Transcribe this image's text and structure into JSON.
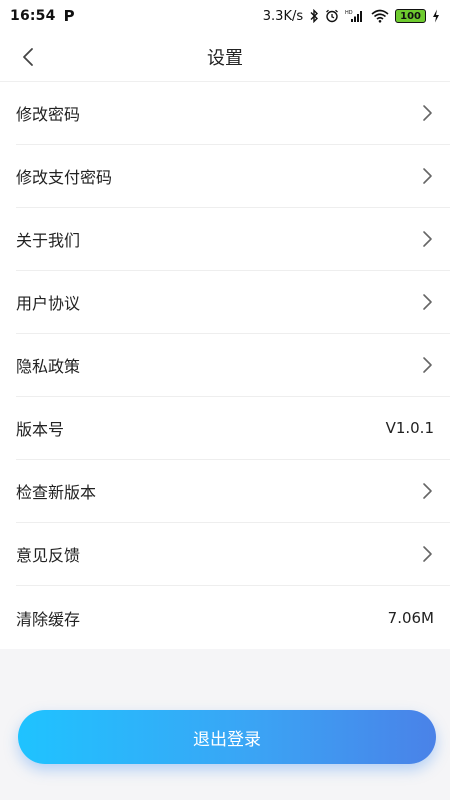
{
  "status_bar": {
    "time": "16:54",
    "app_badge": "P",
    "network_speed": "3.3K/s",
    "hd_label": "HD",
    "battery_level": "100"
  },
  "nav": {
    "title": "设置"
  },
  "settings": [
    {
      "label": "修改密码",
      "type": "link"
    },
    {
      "label": "修改支付密码",
      "type": "link"
    },
    {
      "label": "关于我们",
      "type": "link"
    },
    {
      "label": "用户协议",
      "type": "link"
    },
    {
      "label": "隐私政策",
      "type": "link"
    },
    {
      "label": "版本号",
      "type": "value",
      "value": "V1.0.1"
    },
    {
      "label": "检查新版本",
      "type": "link"
    },
    {
      "label": "意见反馈",
      "type": "link"
    },
    {
      "label": "清除缓存",
      "type": "value",
      "value": "7.06M"
    }
  ],
  "logout": {
    "label": "退出登录"
  },
  "colors": {
    "accent_start": "#1fc3ff",
    "accent_end": "#4a82e8",
    "battery": "#6ecb2f"
  }
}
